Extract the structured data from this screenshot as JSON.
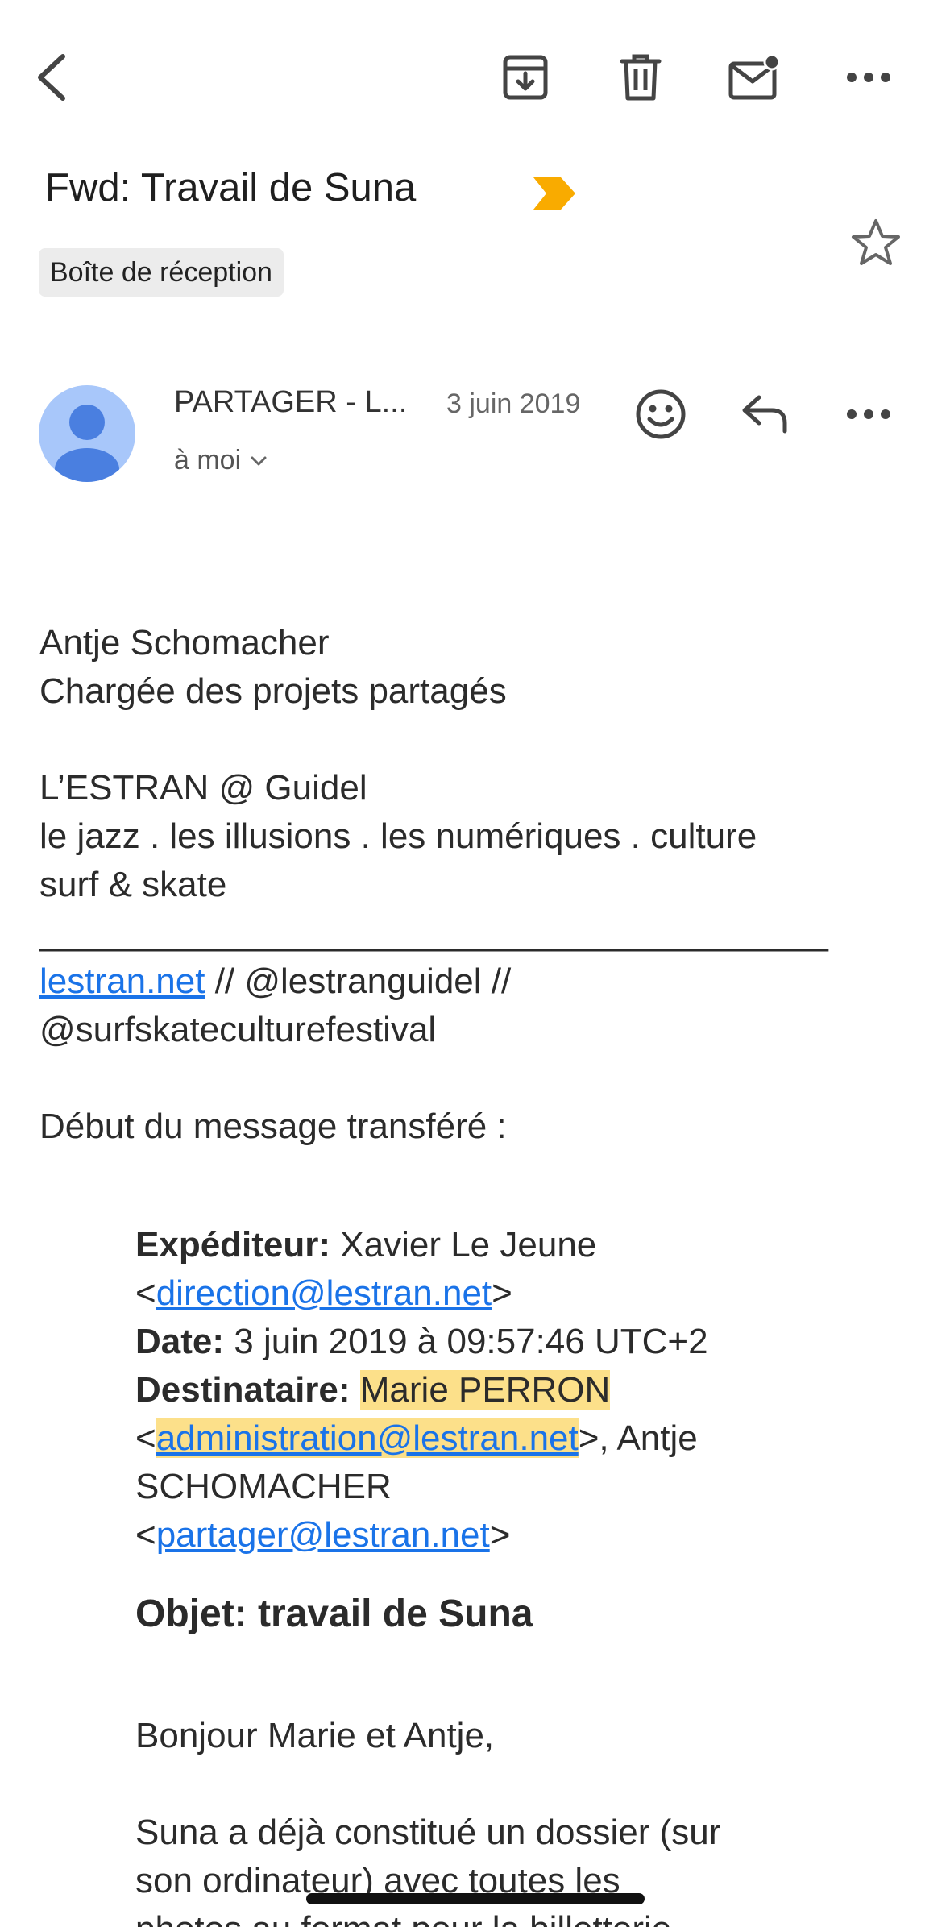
{
  "subject": "Fwd: Travail de Suna",
  "label": "Boîte de réception",
  "sender": {
    "name": "PARTAGER - L...",
    "date": "3 juin 2019",
    "recipient": "à moi"
  },
  "signature": {
    "name": "Antje Schomacher",
    "role": "Chargée des projets partagés",
    "org": "L’ESTRAN @ Guidel",
    "tagline_1": "le jazz . les illusions . les numériques . culture",
    "tagline_2": "surf & skate",
    "divider": "________________________________________",
    "website": "lestran.net",
    "social_1": " // @lestranguidel //",
    "social_2": "@surfskateculturefestival"
  },
  "forward_intro": "Début du message transféré :",
  "forwarded": {
    "from_label": "Expéditeur:",
    "from_name": " Xavier Le Jeune",
    "from_email": "direction@lestran.net",
    "date_label": "Date:",
    "date_value": " 3 juin 2019 à 09:57:46 UTC+2",
    "to_label": "Destinataire:",
    "to_name_1": "Marie PERRON",
    "to_email_1": "administration@lestran.net",
    "to_sep": ">, Antje",
    "to_name_2": "SCHOMACHER",
    "to_email_2": "partager@lestran.net",
    "subject": "Objet: travail de Suna"
  },
  "message": {
    "greeting": "Bonjour Marie et Antje,",
    "line_1": "Suna a déjà constitué un dossier (sur",
    "line_2": "son ordinateur) avec toutes les",
    "line_3": "photos au format pour la billetterie"
  },
  "icons": {
    "back": "back-arrow-icon",
    "archive": "archive-icon",
    "delete": "trash-icon",
    "unread": "mark-unread-icon",
    "more": "more-horizontal-icon",
    "importance": "importance-marker-icon",
    "star": "star-icon",
    "emoji": "emoji-reaction-icon",
    "reply": "reply-icon"
  },
  "colors": {
    "importance": "#f9ab00",
    "link": "#1a73e8",
    "highlight": "#fce08a",
    "avatar_bg": "#a8c7fa",
    "avatar_fg": "#4a7fe0"
  }
}
